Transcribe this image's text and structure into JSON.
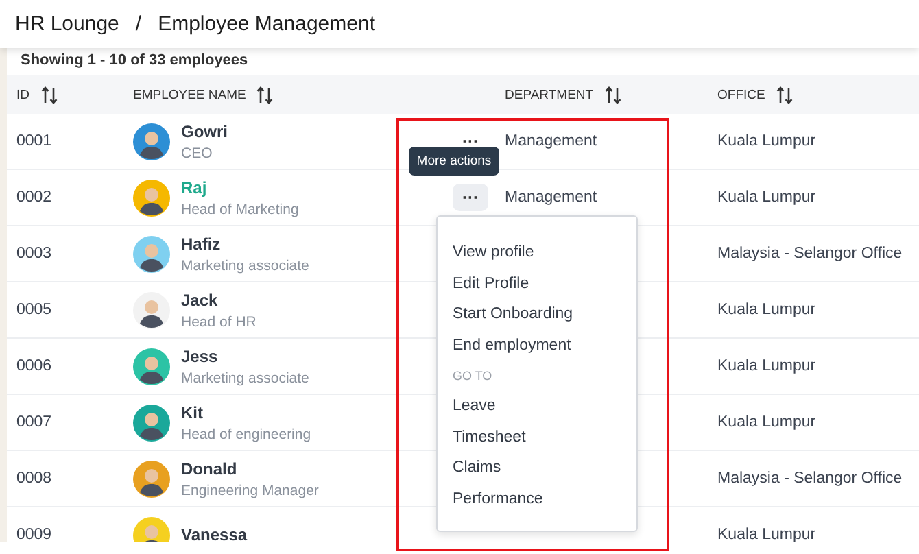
{
  "breadcrumb": [
    "HR Lounge",
    "Employee Management"
  ],
  "breadcrumb_separator": "/",
  "summary": "Showing 1 - 10 of 33 employees",
  "table": {
    "columns": [
      "ID",
      "EMPLOYEE NAME",
      "",
      "DEPARTMENT",
      "OFFICE"
    ],
    "rows": [
      {
        "id": "0001",
        "name": "Gowri",
        "role": "CEO",
        "color": "#2d8fd5",
        "highlighted": false,
        "actions": {
          "label": "···",
          "active": false
        },
        "department": "Management",
        "office": "Kuala Lumpur"
      },
      {
        "id": "0002",
        "name": "Raj",
        "role": "Head of Marketing",
        "color": "#f5b800",
        "highlighted": true,
        "actions": {
          "label": "···",
          "active": true
        },
        "department": "Management",
        "office": "Kuala Lumpur"
      },
      {
        "id": "0003",
        "name": "Hafiz",
        "role": "Marketing associate",
        "color": "#7fd0f0",
        "highlighted": false,
        "office": "Malaysia - Selangor Office"
      },
      {
        "id": "0005",
        "name": "Jack",
        "role": "Head of HR",
        "color": "#f2f2f2",
        "highlighted": false,
        "office": "Kuala Lumpur"
      },
      {
        "id": "0006",
        "name": "Jess",
        "role": "Marketing associate",
        "color": "#2cc3a5",
        "highlighted": false,
        "office": "Kuala Lumpur"
      },
      {
        "id": "0007",
        "name": "Kit",
        "role": "Head of engineering",
        "color": "#1aa89a",
        "highlighted": false,
        "office": "Kuala Lumpur"
      },
      {
        "id": "0008",
        "name": "Donald",
        "role": "Engineering Manager",
        "color": "#e8a020",
        "highlighted": false,
        "office": "Malaysia - Selangor Office"
      },
      {
        "id": "0009",
        "name": "Vanessa",
        "color": "#f5d020",
        "highlighted": false,
        "office": "Kuala Lumpur"
      }
    ]
  },
  "tooltip": "More actions",
  "menu": [
    {
      "kind": "item",
      "label": "View profile"
    },
    {
      "kind": "item",
      "label": "Edit Profile"
    },
    {
      "kind": "item",
      "label": "Start Onboarding"
    },
    {
      "kind": "item",
      "label": "End employment"
    },
    {
      "kind": "section",
      "label": "GO TO"
    },
    {
      "kind": "item",
      "label": "Leave"
    },
    {
      "kind": "item",
      "label": "Timesheet"
    },
    {
      "kind": "item",
      "label": "Claims"
    },
    {
      "kind": "item",
      "label": "Performance"
    }
  ]
}
